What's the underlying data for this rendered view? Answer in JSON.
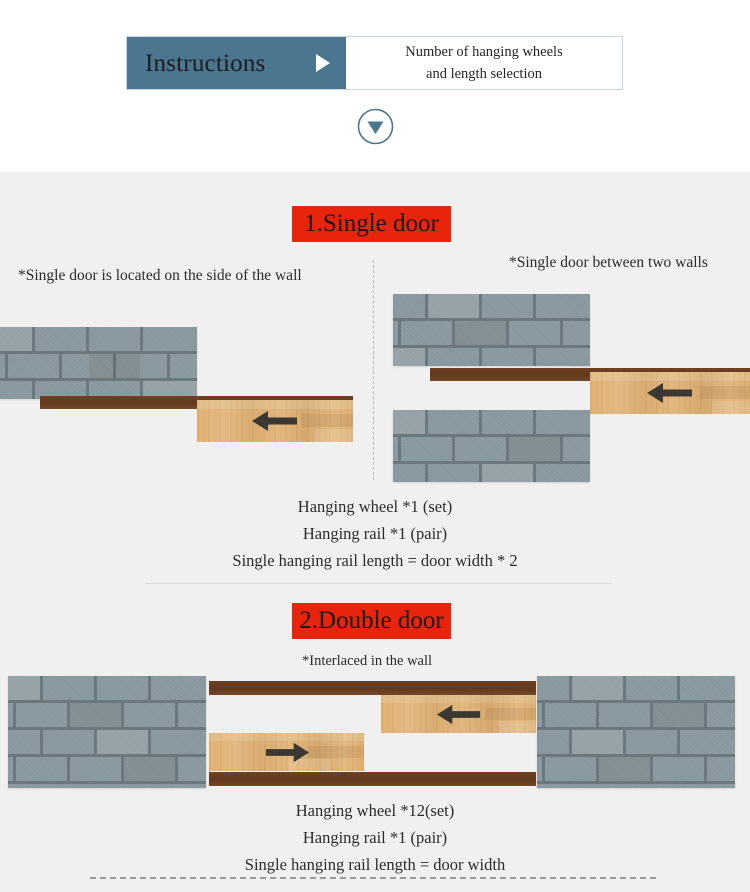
{
  "header": {
    "tab_label": "Instructions",
    "tab_icon": "play-triangle-icon",
    "caption_line1": "Number of hanging wheels",
    "caption_line2": "and length selection",
    "accent_color": "#4a7690"
  },
  "scroll_badge": {
    "icon": "chevron-down-circle-icon",
    "color": "#4a7690"
  },
  "sections": [
    {
      "banner": "1.Single door",
      "banner_color": "#e8250c",
      "note_left": "*Single door is located on the side of the wall",
      "note_right": "*Single door between two walls",
      "spec": [
        "Hanging wheel *1 (set)",
        "Hanging rail *1 (pair)",
        "Single hanging rail length = door width * 2"
      ]
    },
    {
      "banner": "2.Double door",
      "banner_color": "#e8250c",
      "note_center": "*Interlaced in the wall",
      "spec": [
        "Hanging wheel *12(set)",
        "Hanging rail *1 (pair)",
        "Single hanging rail length = door width"
      ]
    }
  ],
  "diagrams": {
    "arrow_left_icon": "arrow-left-icon",
    "arrow_right_icon": "arrow-right-icon",
    "wall_color": "#8a9aa0",
    "rail_color": "#63391c",
    "door_color": "#e2b476"
  }
}
